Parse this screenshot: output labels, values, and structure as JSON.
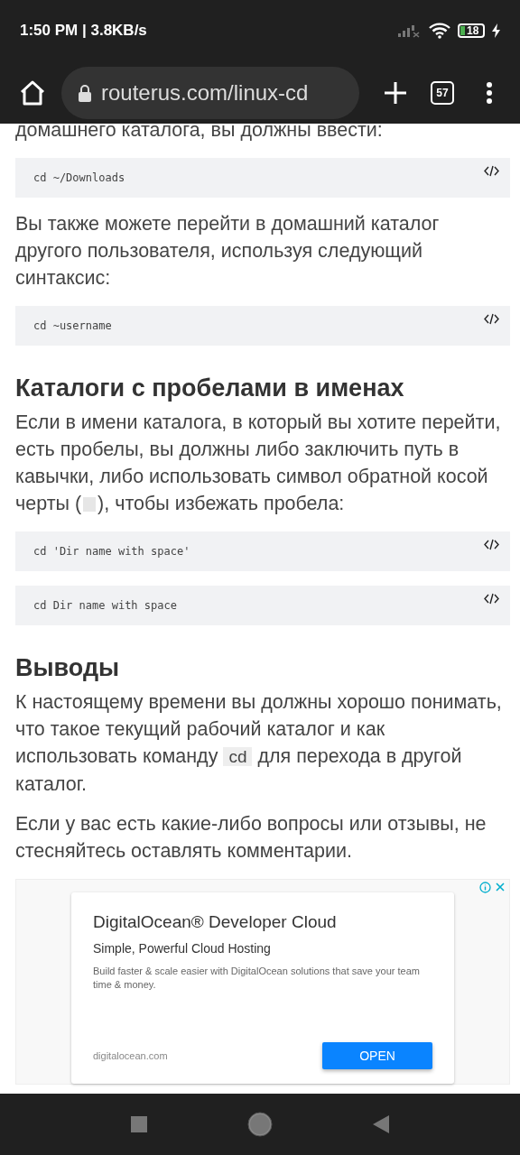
{
  "status_bar": {
    "time": "1:50 PM | 3.8KB/s",
    "battery": "18"
  },
  "toolbar": {
    "url": "routerus.com/linux-cd",
    "tab_count": "57"
  },
  "article": [
    {
      "kind": "paragraph",
      "parts": [
        {
          "kind": "text",
          "text": "домашнего каталога, вы должны ввести:"
        }
      ]
    },
    {
      "kind": "code",
      "text": "cd ~/Downloads"
    },
    {
      "kind": "paragraph",
      "parts": [
        {
          "kind": "text",
          "text": "Вы также можете перейти в домашний каталог другого пользователя, используя следующий синтаксис:"
        }
      ]
    },
    {
      "kind": "code",
      "text": "cd ~username"
    },
    {
      "kind": "heading",
      "text": "Каталоги с пробелами в именах"
    },
    {
      "kind": "paragraph",
      "parts": [
        {
          "kind": "text",
          "text": "Если в имени каталога, в который вы хотите перейти, есть пробелы, вы должны либо заключить путь в кавычки, либо использовать символ обратной косой черты ("
        },
        {
          "kind": "blank_code"
        },
        {
          "kind": "text",
          "text": "), чтобы избежать пробела:"
        }
      ]
    },
    {
      "kind": "code",
      "text": "cd 'Dir name with space'"
    },
    {
      "kind": "code",
      "text": "cd Dir name with space"
    },
    {
      "kind": "heading",
      "text": "Выводы"
    },
    {
      "kind": "paragraph",
      "parts": [
        {
          "kind": "text",
          "text": "К настоящему времени вы должны хорошо понимать, что такое текущий рабочий каталог и как использовать команду "
        },
        {
          "kind": "code",
          "text": "cd"
        },
        {
          "kind": "text",
          "text": " для перехода в другой каталог."
        }
      ]
    },
    {
      "kind": "paragraph",
      "parts": [
        {
          "kind": "text",
          "text": "Если у вас есть какие-либо вопросы или отзывы, не стесняйтесь оставлять комментарии."
        }
      ]
    },
    {
      "kind": "ad",
      "title": "DigitalOcean® Developer Cloud",
      "subtitle": "Simple, Powerful Cloud Hosting",
      "body": "Build faster & scale easier with DigitalOcean solutions that save your team time & money.",
      "domain": "digitalocean.com",
      "button": "OPEN"
    }
  ]
}
